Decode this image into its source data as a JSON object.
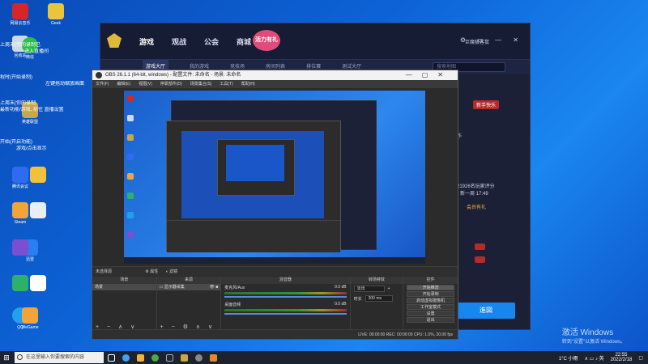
{
  "desktop": {
    "icons": [
      {
        "label": "网易云音乐",
        "color": "#d6262a"
      },
      {
        "label": "Geek",
        "color": "#e8c53a"
      },
      {
        "label": "回收站",
        "color": "#cfd8e6"
      },
      {
        "label": "微信",
        "color": "#2fbd4a"
      },
      {
        "label": "腾讯会议",
        "color": "#2d6cf0"
      },
      {
        "label": "英雄联盟",
        "color": "#c8a74a"
      },
      {
        "label": "Steam",
        "color": "#1b2838"
      },
      {
        "label": "迅雷",
        "color": "#2a7ff0"
      },
      {
        "label": "QQ",
        "color": "#23a0ec"
      },
      {
        "label": "WeGame",
        "color": "#f2a33a"
      }
    ],
    "side_text": [
      "上周末(你的录制已",
      "进入直播间",
      "程时(开始录制)",
      "左键拖动缩放画面",
      "上周末(你的录制",
      "最新功能/游戏, 前往 直播设置",
      "开始(开启功能)",
      "退出",
      "游戏/点击显示"
    ],
    "watermark_line1": "激活 Windows",
    "watermark_line2": "转到\"设置\"以激活 Windows。"
  },
  "game_client": {
    "nav": [
      "游戏",
      "观战",
      "公会",
      "商城"
    ],
    "badge": "活力有礼",
    "user": "巨魔极客鼠",
    "sub_nav": [
      "游戏大厅",
      "我的游戏",
      "竞技场",
      "房间列表",
      "排位赛",
      "测试大厅"
    ],
    "search_placeholder": "搜索地图",
    "right_labels": [
      "新手快乐",
      "作",
      "21926名玩家评分",
      "新一周 17:49",
      "会员有礼"
    ],
    "join_button": "進図"
  },
  "obs": {
    "title": "OBS 26.1.1 (64-bit, windows) - 配置文件: 未命名 - 场景: 未命名",
    "menu": [
      "文件(F)",
      "编辑(E)",
      "视图(V)",
      "停靠部件(D)",
      "场景集合(S)",
      "工具(T)",
      "帮助(H)"
    ],
    "no_source": "未选择源",
    "properties": "属性",
    "filters": "滤镜",
    "docks": {
      "scenes_title": "场景",
      "sources_title": "来源",
      "mixer_title": "混音器",
      "transitions_title": "转场特效",
      "controls_title": "控件",
      "scene_item": "场景",
      "source_item": "显示器采集",
      "mixer_channels": [
        {
          "name": "麦克风/Aux",
          "db": "0.0 dB"
        },
        {
          "name": "桌面音频",
          "db": "0.0 dB"
        }
      ],
      "transition_type": "淡出",
      "duration_label": "时长",
      "duration_value": "300 ms",
      "controls": [
        "开始推流",
        "开始录制",
        "启动虚拟摄像机",
        "工作室模式",
        "设置",
        "退出"
      ]
    },
    "status": "LIVE: 00:00:00    REC: 00:00:00    CPU: 1.0%, 30.00 fps"
  },
  "taskbar": {
    "search_placeholder": "在这里输入你要搜索的内容",
    "app_colors": [
      "#ffffff",
      "#3ba3f5",
      "#f2b33a",
      "#4ca84c",
      "#1b2838",
      "#c8a74a",
      "#888888",
      "#e08a2a"
    ],
    "weather": "1°C 小雨",
    "time": "22:55",
    "date": "2022/2/18"
  }
}
